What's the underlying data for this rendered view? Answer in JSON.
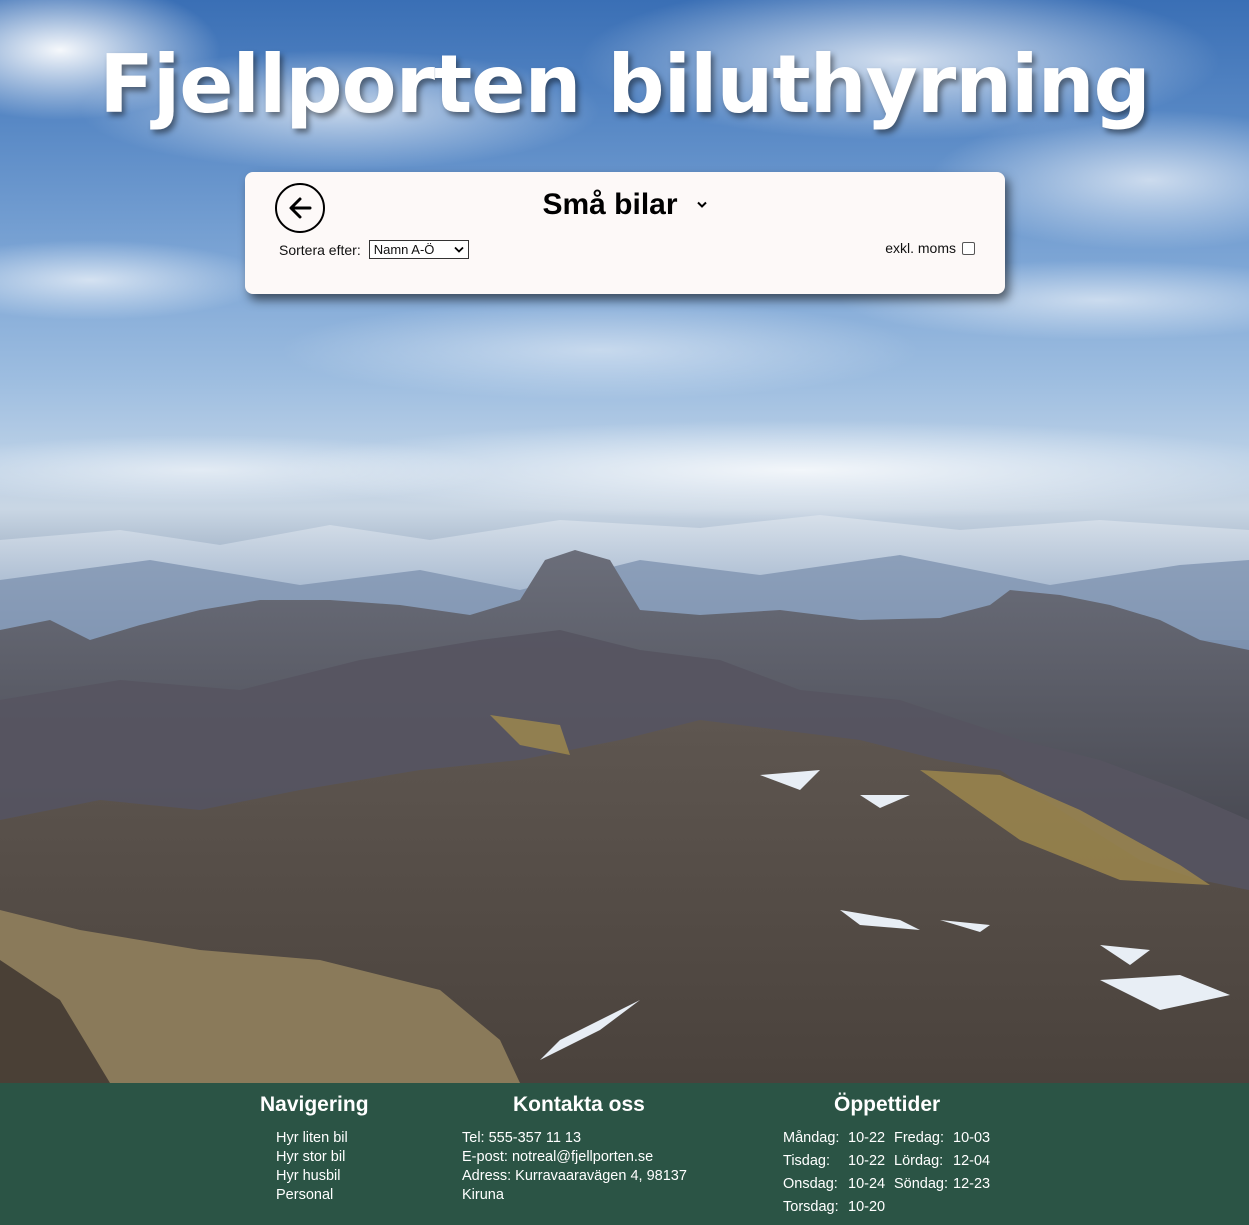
{
  "site": {
    "title": "Fjellporten biluthyrning"
  },
  "panel": {
    "back_icon": "arrow-left-icon",
    "category": "Små bilar",
    "sort_label": "Sortera efter:",
    "sort_value": "Namn A-Ö",
    "vat_label": "exkl. moms",
    "vat_checked": false
  },
  "footer": {
    "nav": {
      "heading": "Navigering",
      "items": [
        "Hyr liten bil",
        "Hyr stor bil",
        "Hyr husbil",
        "Personal"
      ]
    },
    "contact": {
      "heading": "Kontakta oss",
      "lines": [
        "Tel: 555-357 11 13",
        "E-post: notreal@fjellporten.se",
        "Adress: Kurravaaravägen 4, 98137",
        "Kiruna"
      ]
    },
    "hours": {
      "heading": "Öppettider",
      "rows": [
        {
          "day": "Måndag:",
          "time": "10-22",
          "day2": "Fredag:",
          "time2": "10-03"
        },
        {
          "day": "Tisdag:",
          "time": "10-22",
          "day2": "Lördag:",
          "time2": "12-04"
        },
        {
          "day": "Onsdag:",
          "time": "10-24",
          "day2": "Söndag:",
          "time2": "12-23"
        },
        {
          "day": "Torsdag:",
          "time": "10-20",
          "day2": "",
          "time2": ""
        }
      ]
    },
    "background_color": "#2b5445"
  }
}
